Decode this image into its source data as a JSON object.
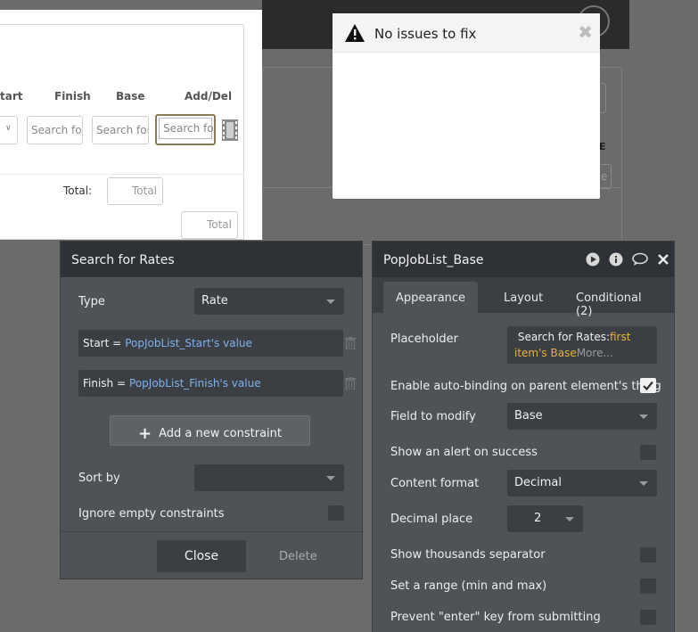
{
  "canvas": {
    "columns": [
      "tart",
      "Finish",
      "Base",
      "Add/Del"
    ],
    "search_placeholder": "Search for",
    "total_label": "Total:",
    "total_placeholder": "Total"
  },
  "background": {
    "letter_e": "E",
    "letter_e2": "e"
  },
  "issues": {
    "title": "No issues to fix",
    "close": "✖"
  },
  "search_rates": {
    "title": "Search for Rates",
    "type_label": "Type",
    "type_value": "Rate",
    "constraints": [
      {
        "field": "Start =",
        "value": "PopJobList_Start's value"
      },
      {
        "field": "Finish =",
        "value": "PopJobList_Finish's value"
      }
    ],
    "add_constraint": "Add a new constraint",
    "sort_by_label": "Sort by",
    "sort_by_value": "",
    "ignore_empty_label": "Ignore empty constraints",
    "ignore_empty_checked": false,
    "close_label": "Close",
    "delete_label": "Delete"
  },
  "properties": {
    "title": "PopJobList_Base",
    "tabs": [
      "Appearance",
      "Layout",
      "Conditional (2)"
    ],
    "active_tab": "Appearance",
    "placeholder_label": "Placeholder",
    "placeholder_prefix": "Search for Rates:",
    "placeholder_gold1": "first",
    "placeholder_gold2": "item's Base",
    "placeholder_more": "More...",
    "auto_binding_label": "Enable auto-binding on parent element's thing",
    "auto_binding_checked": true,
    "field_label": "Field to modify",
    "field_value": "Base",
    "alert_label": "Show an alert on success",
    "content_format_label": "Content format",
    "content_format_value": "Decimal",
    "decimal_label": "Decimal place",
    "decimal_value": "2",
    "thousands_label": "Show thousands separator",
    "range_label": "Set a range (min and max)",
    "enter_label": "Prevent \"enter\" key from submitting"
  }
}
